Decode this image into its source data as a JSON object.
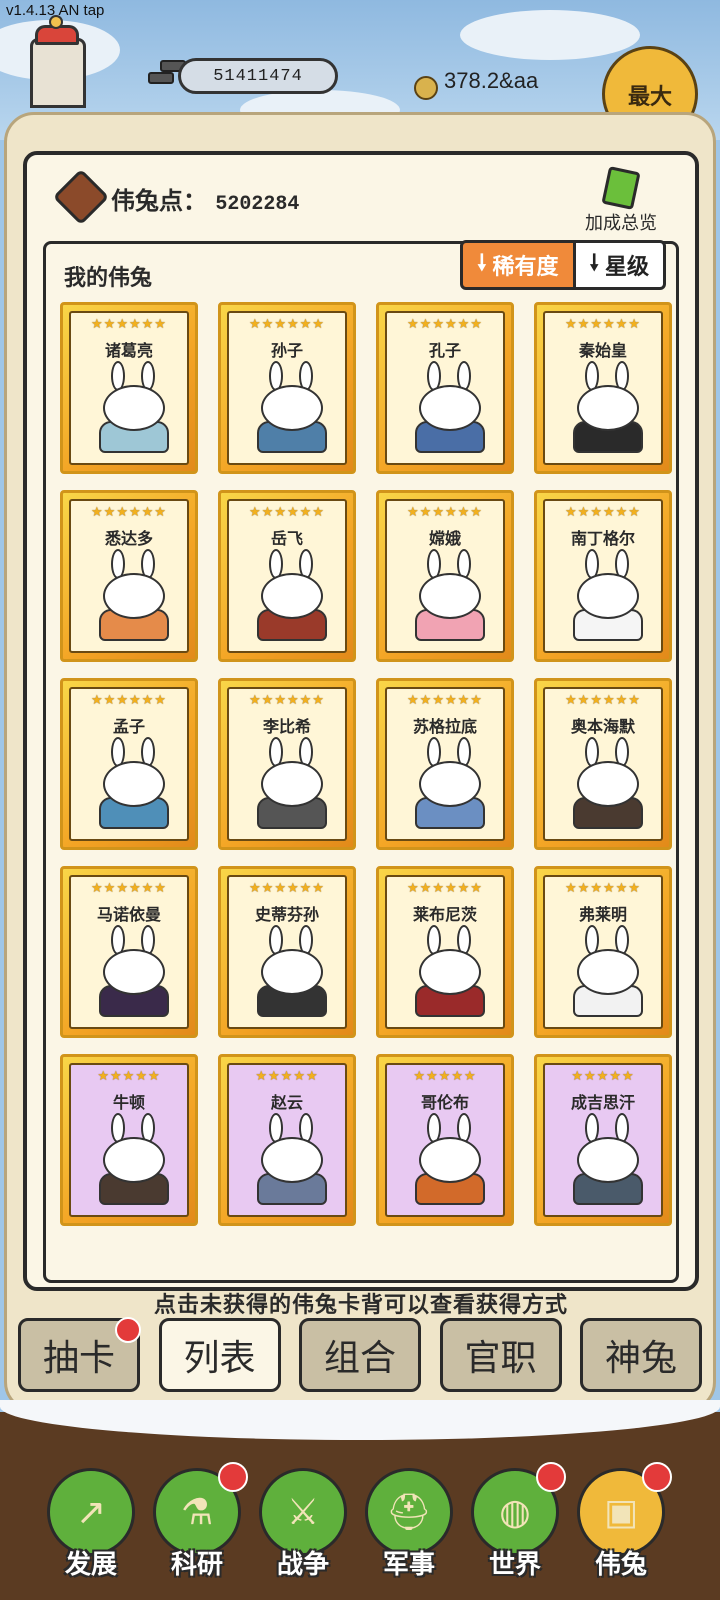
{
  "status": {
    "version": "v1.4.13 AN tap"
  },
  "top": {
    "money": "51411474",
    "coins": "378.2&aa",
    "max_label": "最大"
  },
  "panel": {
    "points_label": "伟兔点：",
    "points_value": "5202284",
    "overview_label": "加成总览",
    "list_title": "我的伟兔",
    "sort_rarity": "稀有度",
    "sort_stars": "星级",
    "hint": "点击未获得的伟兔卡背可以查看获得方式"
  },
  "cards": [
    {
      "name": "诸葛亮",
      "stars": "★★★★★★",
      "tier": "gold",
      "color": "#9ec7d6"
    },
    {
      "name": "孙子",
      "stars": "★★★★★★",
      "tier": "gold",
      "color": "#4f7fa8"
    },
    {
      "name": "孔子",
      "stars": "★★★★★★",
      "tier": "gold",
      "color": "#4a6ea6"
    },
    {
      "name": "秦始皇",
      "stars": "★★★★★★",
      "tier": "gold",
      "color": "#2a2a2a"
    },
    {
      "name": "悉达多",
      "stars": "★★★★★★",
      "tier": "gold",
      "color": "#e58b4a"
    },
    {
      "name": "岳飞",
      "stars": "★★★★★★",
      "tier": "gold",
      "color": "#9a3a2a"
    },
    {
      "name": "嫦娥",
      "stars": "★★★★★★",
      "tier": "gold",
      "color": "#f1a3b3"
    },
    {
      "name": "南丁格尔",
      "stars": "★★★★★★",
      "tier": "gold",
      "color": "#f5f5f5"
    },
    {
      "name": "孟子",
      "stars": "★★★★★★",
      "tier": "gold",
      "color": "#4f8fb8"
    },
    {
      "name": "李比希",
      "stars": "★★★★★★",
      "tier": "gold",
      "color": "#555555"
    },
    {
      "name": "苏格拉底",
      "stars": "★★★★★★",
      "tier": "gold",
      "color": "#6b8fc2"
    },
    {
      "name": "奥本海默",
      "stars": "★★★★★★",
      "tier": "gold",
      "color": "#4a3a30"
    },
    {
      "name": "马诺依曼",
      "stars": "★★★★★★",
      "tier": "gold",
      "color": "#3a2a4a"
    },
    {
      "name": "史蒂芬孙",
      "stars": "★★★★★★",
      "tier": "gold",
      "color": "#333333"
    },
    {
      "name": "莱布尼茨",
      "stars": "★★★★★★",
      "tier": "gold",
      "color": "#9a2a2a"
    },
    {
      "name": "弗莱明",
      "stars": "★★★★★★",
      "tier": "gold",
      "color": "#f2f2f2"
    },
    {
      "name": "牛顿",
      "stars": "★★★★★",
      "tier": "purple",
      "color": "#4a3a30"
    },
    {
      "name": "赵云",
      "stars": "★★★★★",
      "tier": "purple",
      "color": "#6a7a9a"
    },
    {
      "name": "哥伦布",
      "stars": "★★★★★",
      "tier": "purple",
      "color": "#d26a2a"
    },
    {
      "name": "成吉思汗",
      "stars": "★★★★★",
      "tier": "purple",
      "color": "#4a5a6a"
    }
  ],
  "tabs": [
    {
      "label": "抽卡",
      "dot": true
    },
    {
      "label": "列表",
      "dot": false,
      "active": true
    },
    {
      "label": "组合",
      "dot": false
    },
    {
      "label": "官职",
      "dot": false
    },
    {
      "label": "神兔",
      "dot": false
    }
  ],
  "nav": [
    {
      "label": "发展",
      "icon": "trend-up-icon",
      "glyph": "↗",
      "dot": false
    },
    {
      "label": "科研",
      "icon": "flask-icon",
      "glyph": "⚗",
      "dot": true
    },
    {
      "label": "战争",
      "icon": "swords-icon",
      "glyph": "⚔",
      "dot": false
    },
    {
      "label": "军事",
      "icon": "helmet-icon",
      "glyph": "⛑",
      "dot": false
    },
    {
      "label": "世界",
      "icon": "globe-icon",
      "glyph": "◍",
      "dot": true
    },
    {
      "label": "伟兔",
      "icon": "bunny-portrait-icon",
      "glyph": "▣",
      "dot": true,
      "active": true
    }
  ]
}
